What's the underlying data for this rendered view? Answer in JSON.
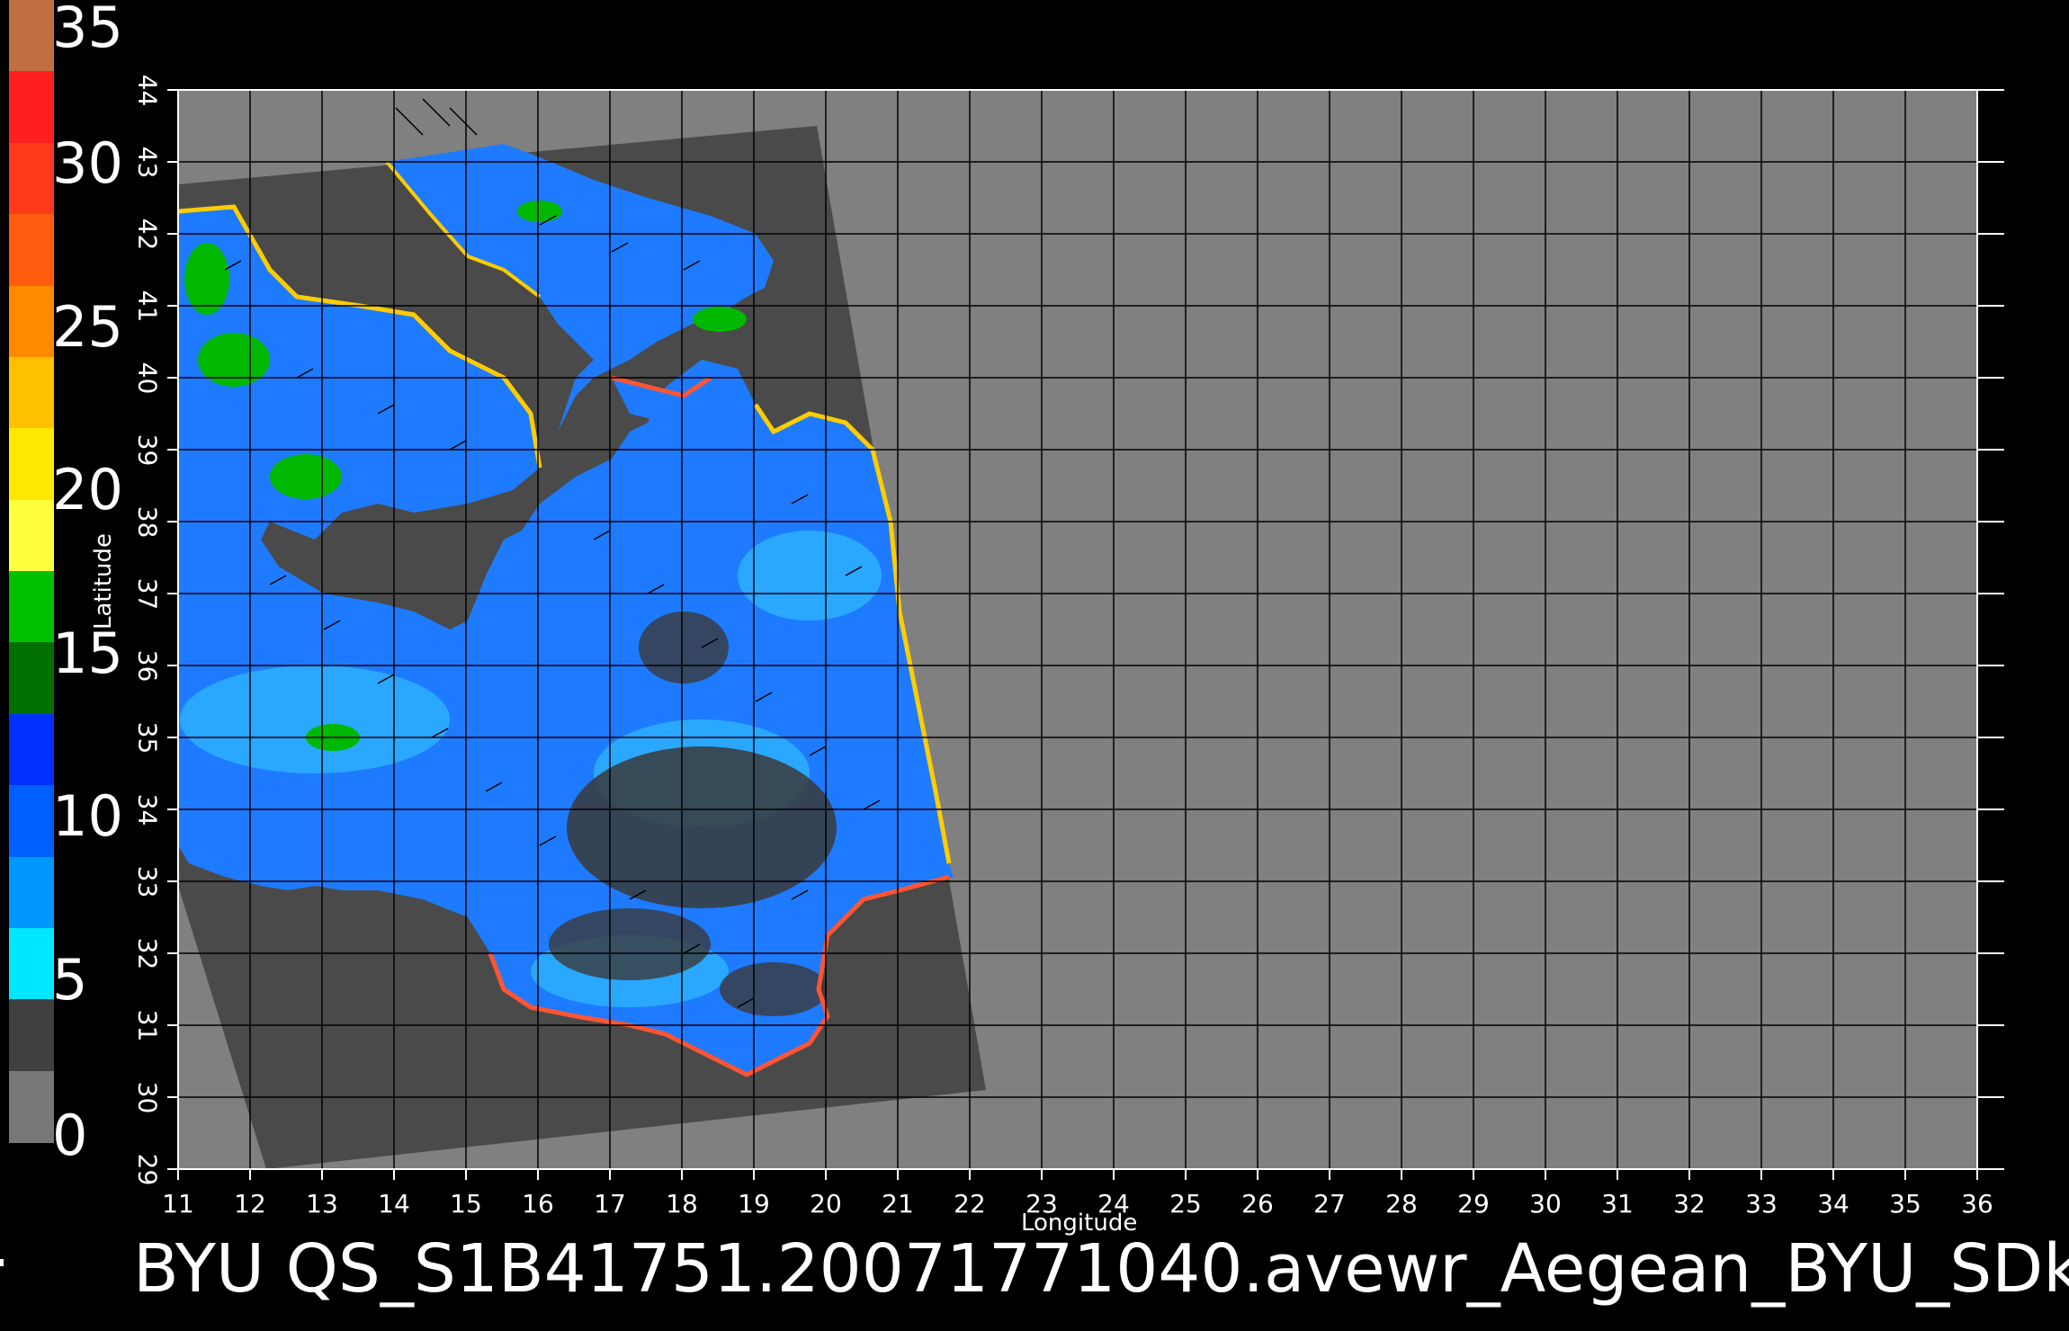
{
  "product_id": "BYU  QS_S1B41751.20071771040.avewr_Aegean_BYU_SDk",
  "axes": {
    "xlabel": "Longitude",
    "ylabel": "Latitude",
    "x_ticks": [
      "11",
      "12",
      "13",
      "14",
      "15",
      "16",
      "17",
      "18",
      "19",
      "20",
      "21",
      "22",
      "23",
      "24",
      "25",
      "26",
      "27",
      "28",
      "29",
      "30",
      "31",
      "32",
      "33",
      "34",
      "35",
      "36"
    ],
    "y_ticks": [
      "29",
      "30",
      "31",
      "32",
      "33",
      "34",
      "35",
      "36",
      "37",
      "38",
      "39",
      "40",
      "41",
      "42",
      "43",
      "44"
    ]
  },
  "colorbar": {
    "labels": [
      "35",
      "30",
      "25",
      "20",
      "15",
      "10",
      "5",
      "0"
    ],
    "segments": [
      {
        "color": "#c07040"
      },
      {
        "color": "#ff1f1f"
      },
      {
        "color": "#ff3a1a"
      },
      {
        "color": "#ff5c10"
      },
      {
        "color": "#ff8a00"
      },
      {
        "color": "#ffc000"
      },
      {
        "color": "#ffe800"
      },
      {
        "color": "#ffff40"
      },
      {
        "color": "#00c000"
      },
      {
        "color": "#007000"
      },
      {
        "color": "#0030ff"
      },
      {
        "color": "#0060ff"
      },
      {
        "color": "#0098ff"
      },
      {
        "color": "#00e8ff"
      },
      {
        "color": "#404040"
      },
      {
        "color": "#777777"
      }
    ]
  },
  "colors": {
    "background": "#000000",
    "nodata": "#808080",
    "swath": "#4a4a4a",
    "grid": "#000000"
  }
}
